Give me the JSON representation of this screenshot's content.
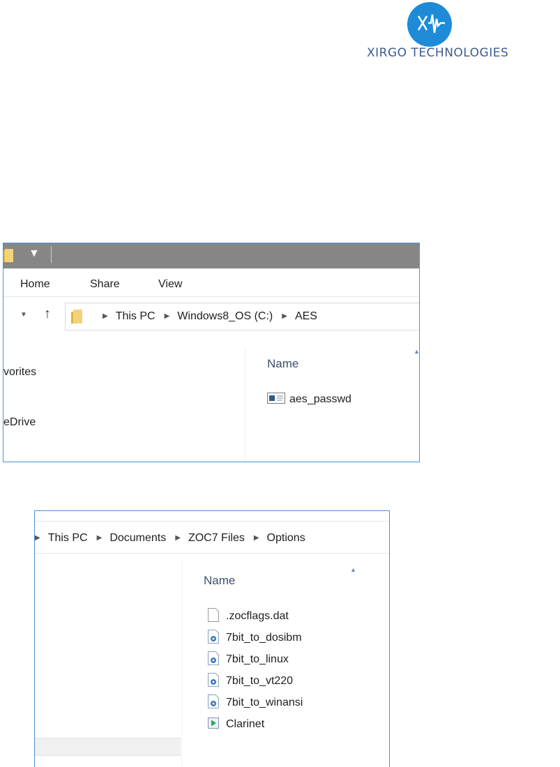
{
  "logo": {
    "text": "XIRGO TECHNOLOGIES"
  },
  "explorer_aes": {
    "ribbon_tabs": [
      "Home",
      "Share",
      "View"
    ],
    "breadcrumb": [
      "This PC",
      "Windows8_OS (C:)",
      "AES"
    ],
    "nav_pane": [
      "vorites",
      "eDrive"
    ],
    "column_header": "Name",
    "files": [
      "aes_passwd"
    ]
  },
  "explorer_zoc": {
    "breadcrumb": [
      "This PC",
      "Documents",
      "ZOC7 Files",
      "Options"
    ],
    "column_header": "Name",
    "files": [
      {
        "name": ".zocflags.dat",
        "icon": "blank-file-icon"
      },
      {
        "name": "7bit_to_dosibm",
        "icon": "script-file-icon"
      },
      {
        "name": "7bit_to_linux",
        "icon": "script-file-icon"
      },
      {
        "name": "7bit_to_vt220",
        "icon": "script-file-icon"
      },
      {
        "name": "7bit_to_winansi",
        "icon": "script-file-icon"
      },
      {
        "name": "Clarinet",
        "icon": "media-file-icon"
      }
    ]
  },
  "colors": {
    "brand": "#1d8bd8",
    "window_border": "#4a90d9",
    "titlebar": "#868686"
  }
}
